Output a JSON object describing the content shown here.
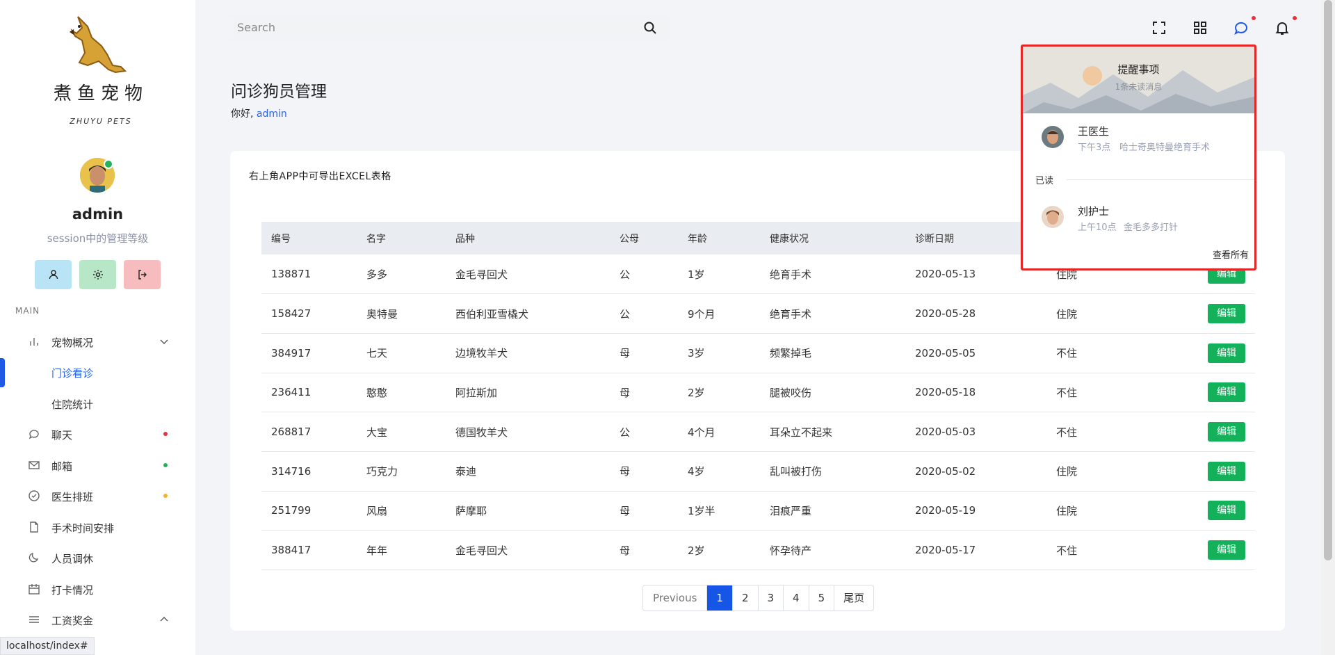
{
  "brand": {
    "title": "煮鱼宠物",
    "subtitle": "ZHUYU PETS"
  },
  "profile": {
    "name": "admin",
    "role": "session中的管理等级"
  },
  "nav": {
    "section": "MAIN",
    "items": [
      {
        "label": "宠物概况"
      },
      {
        "label": "门诊看诊"
      },
      {
        "label": "住院统计"
      },
      {
        "label": "聊天",
        "dot": "#e8323c"
      },
      {
        "label": "邮箱",
        "dot": "#22b45a"
      },
      {
        "label": "医生排班",
        "dot": "#f5b323"
      },
      {
        "label": "手术时间安排"
      },
      {
        "label": "人员调休"
      },
      {
        "label": "打卡情况"
      },
      {
        "label": "工资奖金"
      }
    ]
  },
  "status_url": "localhost/index#",
  "search": {
    "placeholder": "Search"
  },
  "page": {
    "title": "问诊狗员管理",
    "greeting": "你好,",
    "user": "admin"
  },
  "card": {
    "note": "右上角APP中可导出EXCEL表格"
  },
  "table": {
    "headers": [
      "编号",
      "名字",
      "品种",
      "公母",
      "年龄",
      "健康状况",
      "诊断日期",
      "",
      ""
    ],
    "edit_label": "编辑",
    "rows": [
      [
        "138871",
        "多多",
        "金毛寻回犬",
        "公",
        "1岁",
        "绝育手术",
        "2020-05-13",
        "住院"
      ],
      [
        "158427",
        "奥特曼",
        "西伯利亚雪橇犬",
        "公",
        "9个月",
        "绝育手术",
        "2020-05-28",
        "住院"
      ],
      [
        "384917",
        "七天",
        "边境牧羊犬",
        "母",
        "3岁",
        "频繁掉毛",
        "2020-05-05",
        "不住"
      ],
      [
        "236411",
        "憨憨",
        "阿拉斯加",
        "母",
        "2岁",
        "腿被咬伤",
        "2020-05-18",
        "不住"
      ],
      [
        "268817",
        "大宝",
        "德国牧羊犬",
        "公",
        "4个月",
        "耳朵立不起来",
        "2020-05-03",
        "不住"
      ],
      [
        "314716",
        "巧克力",
        "泰迪",
        "母",
        "4岁",
        "乱叫被打伤",
        "2020-05-02",
        "住院"
      ],
      [
        "251799",
        "风扇",
        "萨摩耶",
        "母",
        "1岁半",
        "泪痕严重",
        "2020-05-19",
        "住院"
      ],
      [
        "388417",
        "年年",
        "金毛寻回犬",
        "母",
        "2岁",
        "怀孕待产",
        "2020-05-17",
        "不住"
      ]
    ]
  },
  "pagination": [
    "Previous",
    "1",
    "2",
    "3",
    "4",
    "5",
    "尾页"
  ],
  "notifications": {
    "title": "提醒事项",
    "unread": "1条未读消息",
    "read_label": "已读",
    "view_all": "查看所有",
    "unread_items": [
      {
        "name": "王医生",
        "time": "下午3点",
        "text": "哈士奇奥特曼绝育手术"
      }
    ],
    "read_items": [
      {
        "name": "刘护士",
        "time": "上午10点",
        "text": "金毛多多打针"
      }
    ]
  },
  "colors": {
    "accent": "#1556e6",
    "success": "#12b15a",
    "danger": "#e52626"
  }
}
